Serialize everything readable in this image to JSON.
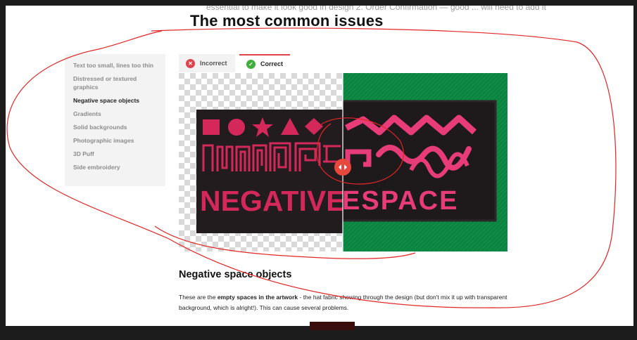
{
  "underlay": {
    "text": "essential to make it look good in design 2. Order Confirmation — good ... will need to add it"
  },
  "page": {
    "title": "The most common issues"
  },
  "sidebar": {
    "items": [
      {
        "label": "Text too small, lines too thin"
      },
      {
        "label": "Distressed or textured graphics"
      },
      {
        "label": "Negative space objects"
      },
      {
        "label": "Gradients"
      },
      {
        "label": "Solid backgrounds"
      },
      {
        "label": "Photographic images"
      },
      {
        "label": "3D Puff"
      },
      {
        "label": "Side embroidery"
      }
    ],
    "active_index": 2
  },
  "tabs": {
    "incorrect": {
      "label": "Incorrect",
      "icon": "close-icon"
    },
    "correct": {
      "label": "Correct",
      "icon": "check-icon"
    }
  },
  "comparison": {
    "left_text": "NEGATIVE",
    "right_text": "ESPACE",
    "slider_icon": "left-right-arrows-icon"
  },
  "section": {
    "heading": "Negative space objects",
    "paragraph_pre": "These are the ",
    "paragraph_bold": "empty spaces in the artwork",
    "paragraph_post": " - the hat fabric showing through the design (but don't mix it up with transparent background, which is alright!). This can cause several problems."
  },
  "colors": {
    "accent_red": "#e0424a",
    "correct_green": "#3fae3a",
    "design_pink": "#d4285a",
    "patch_green": "#0e8a45",
    "annotation_red": "#e32626"
  }
}
